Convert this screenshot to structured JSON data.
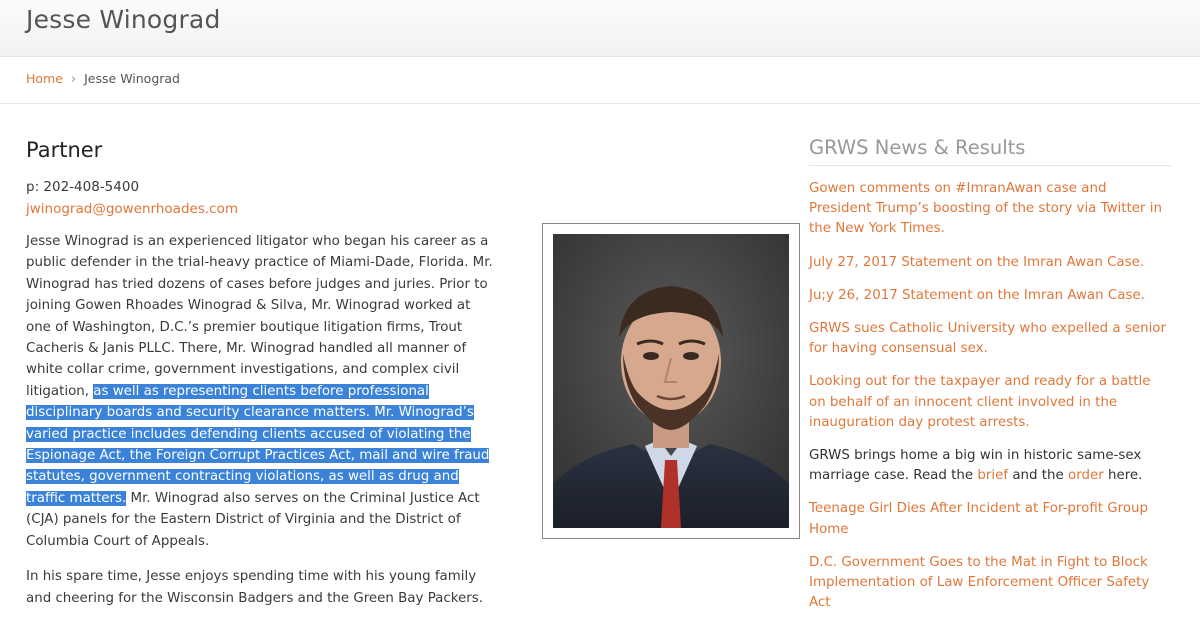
{
  "header": {
    "site_title": "Jesse Winograd"
  },
  "breadcrumb": {
    "home": "Home",
    "separator": "›",
    "current": "Jesse Winograd"
  },
  "profile": {
    "role": "Partner",
    "phone": "p: 202-408-5400",
    "email": "jwinograd@gowenrhoades.com",
    "bio_part1": "Jesse Winograd is an experienced litigator who began his career as a public defender in the trial-heavy practice of Miami-Dade, Florida. Mr. Winograd has tried dozens of cases before judges and juries. Prior to joining Gowen Rhoades Winograd & Silva, Mr. Winograd worked at one of Washington, D.C.’s premier boutique litigation firms, Trout Cacheris & Janis PLLC. There, Mr. Winograd handled all manner of white collar crime, government investigations, and complex civil litigation, ",
    "bio_highlighted": "as well as representing clients before professional disciplinary boards and security clearance matters. Mr. Winograd’s varied practice includes defending clients accused of violating the Espionage Act, the Foreign Corrupt Practices Act, mail and wire fraud statutes, government contracting violations, as well as drug and traffic matters.",
    "bio_part2": " Mr. Winograd also serves on the Criminal Justice Act (CJA) panels for the Eastern District of Virginia and the District of Columbia Court of Appeals.",
    "bio_para2": "In his spare time, Jesse enjoys spending time with his young family and cheering for the Wisconsin Badgers and the Green Bay Packers."
  },
  "sidebar": {
    "title": "GRWS News & Results",
    "items": [
      {
        "label": "Gowen comments on #ImranAwan case and President Trump’s boosting of the story via Twitter in the New York Times."
      },
      {
        "label": "July 27, 2017 Statement on the Imran Awan Case."
      },
      {
        "label": "Ju;y 26, 2017 Statement on the Imran Awan Case."
      },
      {
        "label": "GRWS sues Catholic University who expelled a senior for having consensual sex."
      },
      {
        "label": "Looking out for the taxpayer and ready for a battle on behalf of an innocent client involved in the inauguration day protest arrests."
      },
      {
        "text_before": "GRWS brings home a big win in historic same-sex marriage case. Read the ",
        "link1": "brief",
        "text_middle": " and the ",
        "link2": "order",
        "text_after": " here."
      },
      {
        "label": "Teenage Girl Dies After Incident at For-profit Group Home"
      },
      {
        "label": "D.C. Government Goes to the Mat in Fight to Block Implementation of Law Enforcement Officer Safety Act"
      }
    ]
  },
  "colors": {
    "accent": "#e0773a",
    "highlight": "#3a83d8",
    "text": "#3a3a3a"
  }
}
